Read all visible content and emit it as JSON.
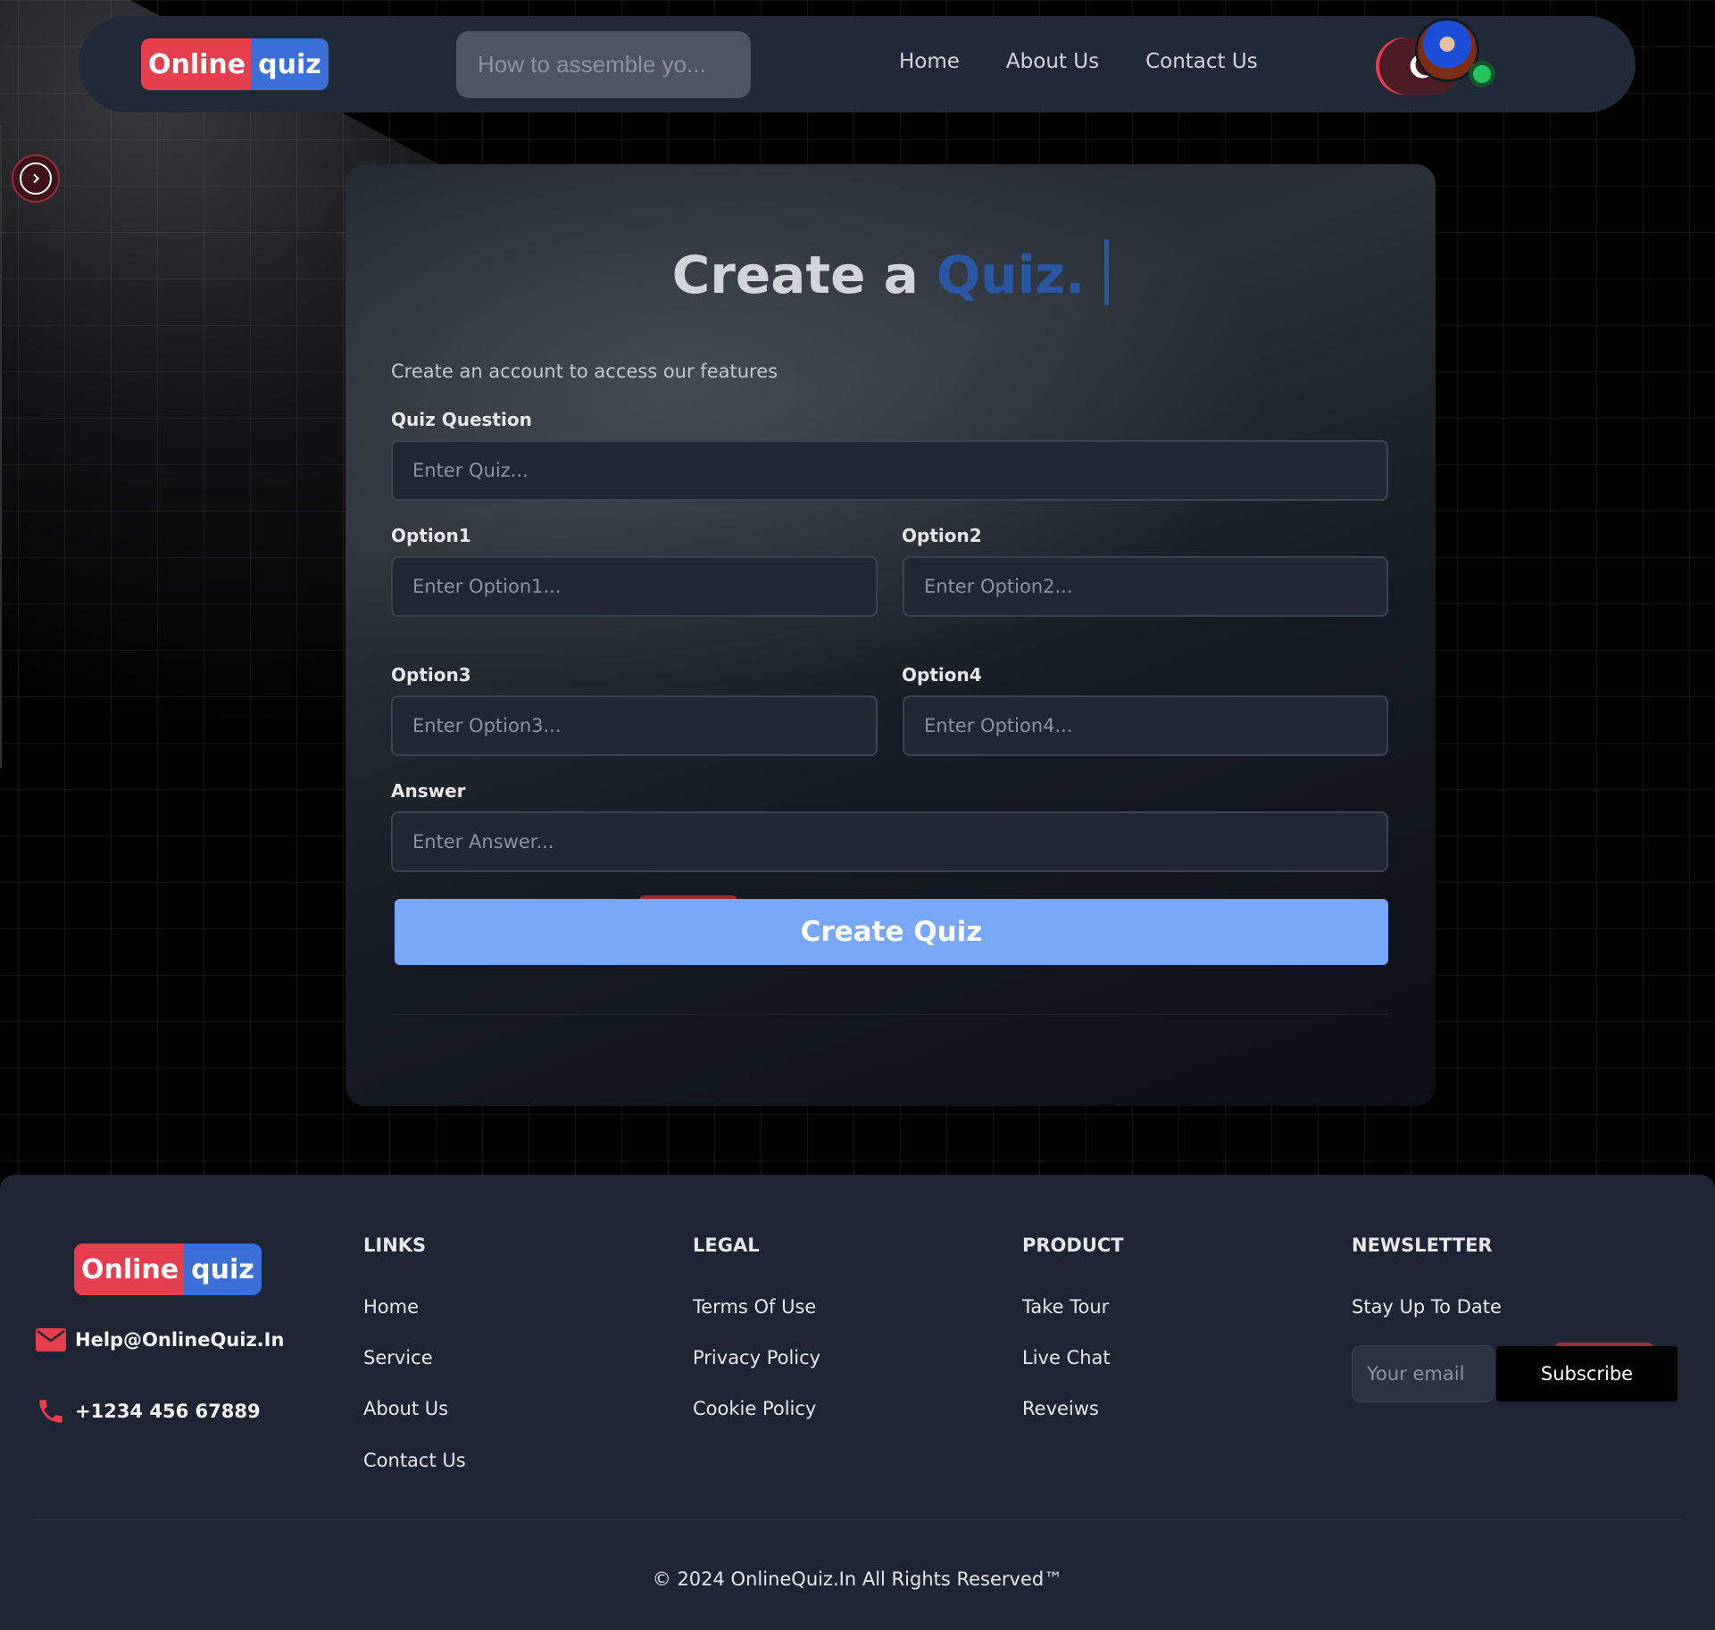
{
  "brand": {
    "logo_part1": "Online",
    "logo_part2": "quiz",
    "colors": {
      "red": "#e53e4d",
      "blue": "#3b6fd8",
      "button": "#78a7f8",
      "title_accent": "#2957a4"
    }
  },
  "header": {
    "search_placeholder": "How to assemble yo...",
    "search_icon": "search-icon",
    "nav": [
      {
        "label": "Home"
      },
      {
        "label": "About Us"
      },
      {
        "label": "Contact Us"
      }
    ],
    "theme_icon": "moon-icon",
    "avatar_status": "online"
  },
  "form": {
    "title_prefix": "Create a ",
    "title_accent": "Quiz.",
    "subtitle": "Create an account to access our features",
    "question_label": "Quiz Question",
    "question_placeholder": "Enter Quiz...",
    "option1_label": "Option1",
    "option1_placeholder": "Enter Option1...",
    "option2_label": "Option2",
    "option2_placeholder": "Enter Option2...",
    "option3_label": "Option3",
    "option3_placeholder": "Enter Option3...",
    "option4_label": "Option4",
    "option4_placeholder": "Enter Option4...",
    "answer_label": "Answer",
    "answer_placeholder": "Enter Answer...",
    "submit_label": "Create Quiz"
  },
  "footer": {
    "email": "Help@OnlineQuiz.In",
    "phone": "+1234 456 67889",
    "links": {
      "heading": "LINKS",
      "items": [
        "Home",
        "Service",
        "About Us",
        "Contact Us"
      ]
    },
    "legal": {
      "heading": "LEGAL",
      "items": [
        "Terms Of Use",
        "Privacy Policy",
        "Cookie Policy"
      ]
    },
    "product": {
      "heading": "PRODUCT",
      "items": [
        "Take Tour",
        "Live Chat",
        "Reveiws"
      ]
    },
    "newsletter": {
      "heading": "NEWSLETTER",
      "text": "Stay Up To Date",
      "email_placeholder": "Your email",
      "button": "Subscribe"
    },
    "copyright": "© 2024 OnlineQuiz.In All Rights Reserved™"
  }
}
